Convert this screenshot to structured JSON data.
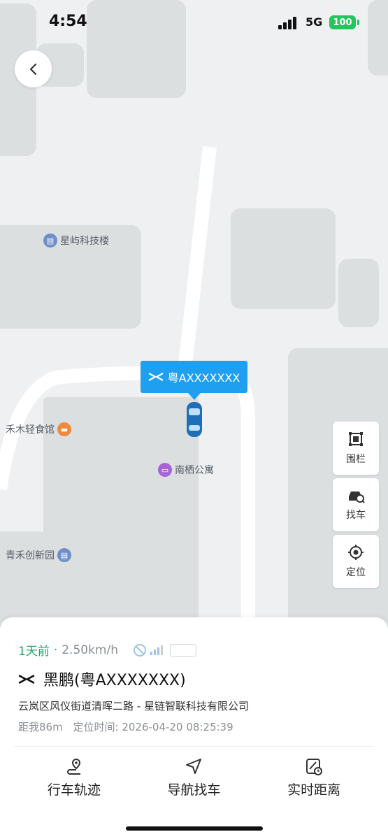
{
  "status_bar": {
    "time": "4:54",
    "network": "5G",
    "battery": "100"
  },
  "map": {
    "pois": [
      {
        "label": "星屿科技楼",
        "icon": "office-icon",
        "color": "#6f8fc9"
      },
      {
        "label": "禾木轻食馆",
        "icon": "food-icon",
        "color": "#f08a3a"
      },
      {
        "label": "南栖公寓",
        "icon": "hotel-icon",
        "color": "#a863d6"
      },
      {
        "label": "青禾创新园",
        "icon": "office-icon",
        "color": "#6f8fc9"
      }
    ],
    "vehicle_tag": "粤AXXXXXXX"
  },
  "tools": [
    {
      "label": "围栏",
      "icon": "fence-icon"
    },
    {
      "label": "找车",
      "icon": "car-search-icon"
    },
    {
      "label": "定位",
      "icon": "locate-icon"
    }
  ],
  "vehicle": {
    "last_seen": "1天前",
    "separator": "·",
    "speed": "2.50km/h",
    "name": "黑鹏(粤AXXXXXXX)",
    "address": "云岚区风仪街道清晖二路 - 星链智联科技有限公司",
    "distance": "距我86m",
    "locate_time_label": "定位时间:",
    "locate_time": "2026-04-20 08:25:39"
  },
  "actions": [
    {
      "label": "行车轨迹",
      "icon": "route-icon"
    },
    {
      "label": "导航找车",
      "icon": "navigation-icon"
    },
    {
      "label": "实时距离",
      "icon": "distance-icon"
    }
  ],
  "colors": {
    "accent": "#1f9ff0",
    "green": "#1aa867"
  }
}
